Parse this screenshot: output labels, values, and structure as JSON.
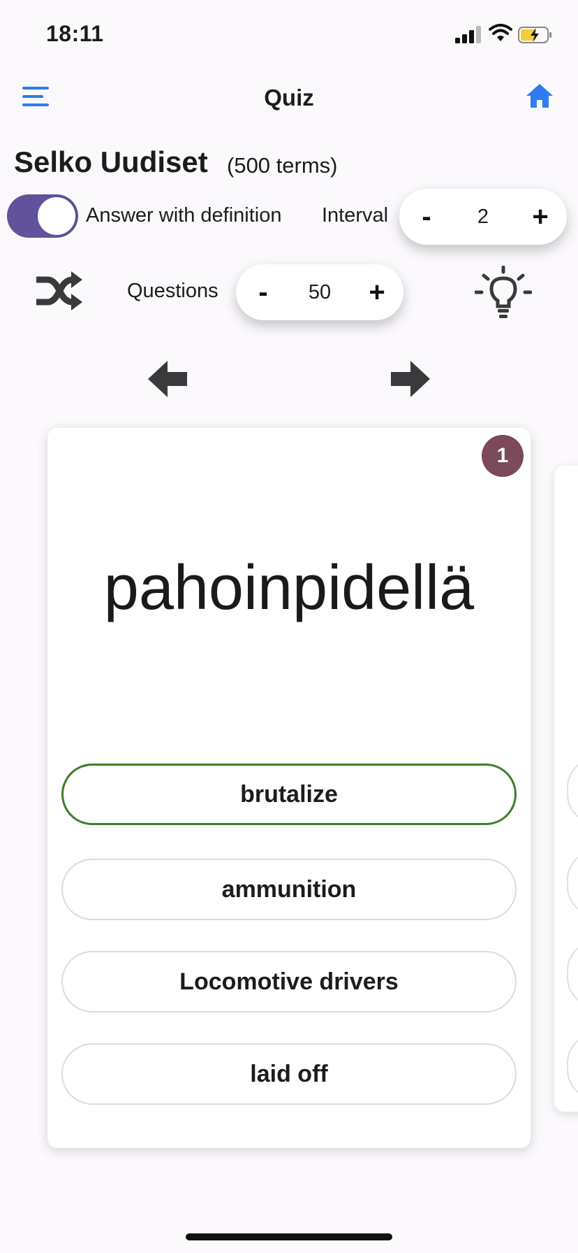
{
  "status_bar": {
    "time": "18:11"
  },
  "nav": {
    "title": "Quiz",
    "menu_icon": "hamburger-menu-icon",
    "home_icon": "home-icon",
    "accent": "#2f7cf0"
  },
  "deck": {
    "title": "Selko Uudiset",
    "count": "(500 terms)"
  },
  "settings": {
    "answer_with_definition_label": "Answer with definition",
    "answer_with_definition_on": true,
    "toggle_color": "#62519b",
    "interval_label": "Interval",
    "interval_value": "2",
    "questions_label": "Questions",
    "questions_value": "50",
    "minus": "-",
    "plus": "+"
  },
  "card": {
    "number": "1",
    "badge_color": "#7a4a5a",
    "term": "pahoinpidellä",
    "answers": [
      {
        "label": "brutalize",
        "state": "correct"
      },
      {
        "label": "ammunition",
        "state": "default"
      },
      {
        "label": "Locomotive drivers",
        "state": "default"
      },
      {
        "label": "laid off",
        "state": "default"
      }
    ],
    "correct_color": "#3e7d28"
  }
}
